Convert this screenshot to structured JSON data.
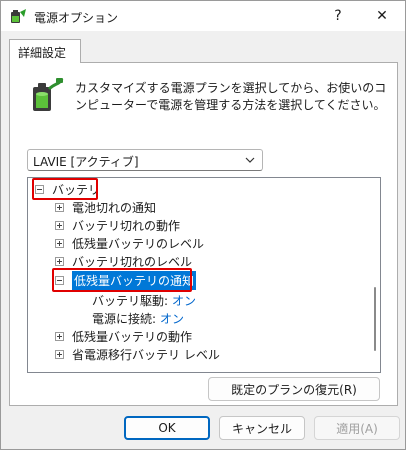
{
  "window": {
    "title": "電源オプション",
    "help_glyph": "?",
    "close_glyph": "✕",
    "app_icon": "power-options-icon"
  },
  "tabs": [
    {
      "label": "詳細設定",
      "active": true
    }
  ],
  "description": "カスタマイズする電源プランを選択してから、お使いのコンピューターで電源を管理する方法を選択してください。",
  "plan_select": {
    "value": "LAVIE [アクティブ]"
  },
  "tree": {
    "root": {
      "label": "バッテリ",
      "expanded": true
    },
    "items": [
      {
        "label": "電池切れの通知",
        "expanded": false
      },
      {
        "label": "バッテリ切れの動作",
        "expanded": false
      },
      {
        "label": "低残量バッテリのレベル",
        "expanded": false
      },
      {
        "label": "バッテリ切れのレベル",
        "expanded": false
      },
      {
        "label": "低残量バッテリの通知",
        "expanded": true,
        "selected": true
      },
      {
        "label": "低残量バッテリの動作",
        "expanded": false
      },
      {
        "label": "省電源移行バッテリ レベル",
        "expanded": false
      }
    ],
    "settings": [
      {
        "label": "バッテリ駆動:",
        "value": "オン"
      },
      {
        "label": "電源に接続:",
        "value": "オン"
      }
    ]
  },
  "buttons": {
    "restore": "既定のプランの復元(R)",
    "ok": "OK",
    "cancel": "キャンセル",
    "apply": "適用(A)"
  },
  "colors": {
    "selection": "#0078d7",
    "highlight_box": "#e00000",
    "value_link": "#0066cc"
  }
}
